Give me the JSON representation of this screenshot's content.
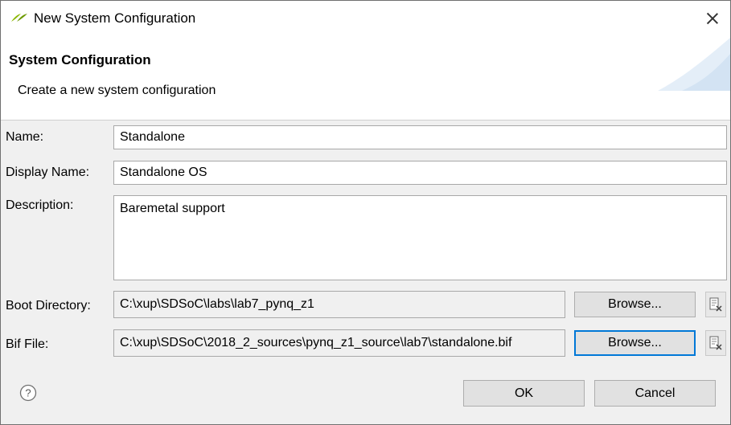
{
  "window": {
    "title": "New System Configuration",
    "app_icon": "xilinx-sdsoc-icon",
    "close_icon": "close-icon"
  },
  "header": {
    "title": "System Configuration",
    "description": "Create a new system configuration"
  },
  "form": {
    "name_label": "Name:",
    "name_value": "Standalone",
    "display_name_label": "Display Name:",
    "display_name_value": "Standalone OS",
    "description_label": "Description:",
    "description_value": "Baremetal support",
    "boot_directory_label": "Boot Directory:",
    "boot_directory_value": "C:\\xup\\SDSoC\\labs\\lab7_pynq_z1",
    "bif_file_label": "Bif File:",
    "bif_file_value": "C:\\xup\\SDSoC\\2018_2_sources\\pynq_z1_source\\lab7\\standalone.bif",
    "browse_label": "Browse...",
    "clear_icon": "clear-field-icon"
  },
  "footer": {
    "help_icon": "help-icon",
    "ok_label": "OK",
    "cancel_label": "Cancel"
  },
  "colors": {
    "focus_blue": "#0078d7",
    "dialog_bg": "#f0f0f0",
    "button_bg": "#e1e1e1",
    "logo_green": "#8ab700"
  }
}
